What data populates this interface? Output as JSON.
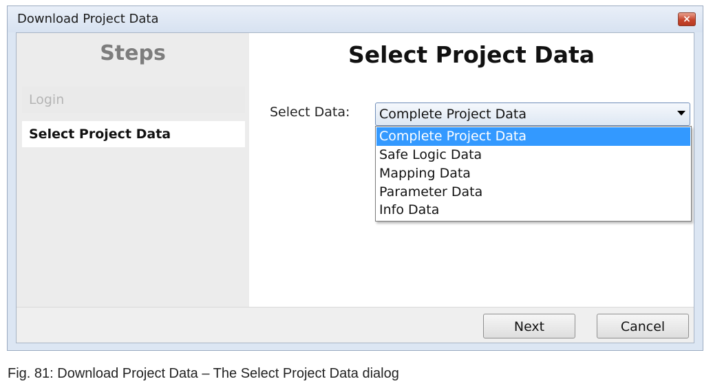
{
  "window": {
    "title": "Download Project Data",
    "close_symbol": "×"
  },
  "steps": {
    "heading": "Steps",
    "items": [
      {
        "label": "Login",
        "state": "inactive"
      },
      {
        "label": "Select Project Data",
        "state": "active"
      }
    ]
  },
  "main": {
    "title": "Select Project Data",
    "select_label": "Select Data:",
    "combo_value": "Complete Project Data",
    "options": [
      "Complete Project Data",
      "Safe Logic Data",
      "Mapping Data",
      "Parameter Data",
      "Info Data"
    ],
    "selected_index": 0
  },
  "footer": {
    "next_label": "Next",
    "cancel_label": "Cancel"
  },
  "caption": "Fig. 81: Download Project Data – The Select Project Data dialog",
  "colors": {
    "selection": "#3399ff",
    "close_button": "#c6452c",
    "frame": "#dce6f3"
  }
}
